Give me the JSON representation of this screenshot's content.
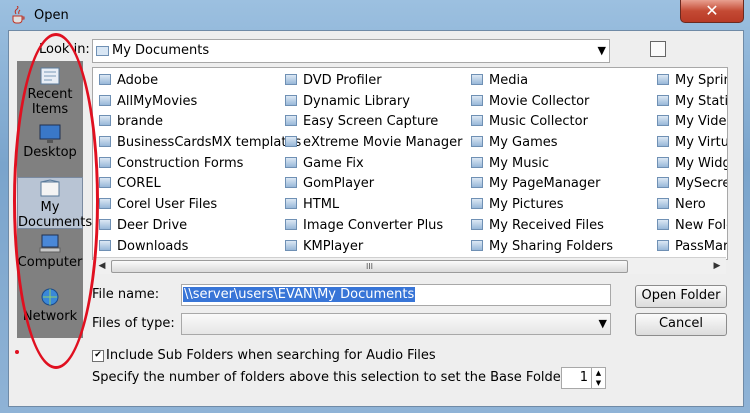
{
  "window": {
    "title": "Open",
    "close_symbol": "✕"
  },
  "lookin": {
    "label": "Look in:",
    "value": "My Documents"
  },
  "places": [
    {
      "label": "Recent Items",
      "icon": "recent-items-icon"
    },
    {
      "label": "Desktop",
      "icon": "desktop-icon"
    },
    {
      "label": "My Documents",
      "icon": "my-documents-icon"
    },
    {
      "label": "Computer",
      "icon": "computer-icon"
    },
    {
      "label": "Network",
      "icon": "network-icon"
    }
  ],
  "files": {
    "col1": [
      "Adobe",
      "AllMyMovies",
      "brande",
      "BusinessCardsMX templates",
      "Construction Forms",
      "COREL",
      "Corel User Files",
      "Deer Drive",
      "Downloads"
    ],
    "col2": [
      "DVD Profiler",
      "Dynamic Library",
      "Easy Screen Capture",
      "eXtreme Movie Manager",
      "Game Fix",
      "GomPlayer",
      "HTML",
      "Image Converter Plus",
      "KMPlayer"
    ],
    "col3": [
      "Media",
      "Movie Collector",
      "Music Collector",
      "My Games",
      "My Music",
      "My PageManager",
      "My Pictures",
      "My Received Files",
      "My Sharing Folders"
    ],
    "col4": [
      "My Spring",
      "My Statio",
      "My Video",
      "My Virtua",
      "My Widge",
      "MySecretF",
      "Nero",
      "New Folde",
      "PassMark"
    ]
  },
  "scrollbar": {
    "left": "◀",
    "right": "▶",
    "grip": "III"
  },
  "form": {
    "filename_label": "File name:",
    "filename_value": "\\\\server\\users\\EVAN\\My Documents",
    "filetype_label": "Files of type:",
    "filetype_value": "",
    "open_button": "Open Folder",
    "cancel_button": "Cancel"
  },
  "options": {
    "include_subfolders_label": "Include Sub Folders when searching for Audio Files",
    "include_subfolders_checked": true,
    "base_folder_label": "Specify the number of folders above this selection to set the Base Folder to",
    "base_folder_value": "1"
  },
  "colors": {
    "annotation": "#e01020",
    "selection": "#3875d7"
  }
}
